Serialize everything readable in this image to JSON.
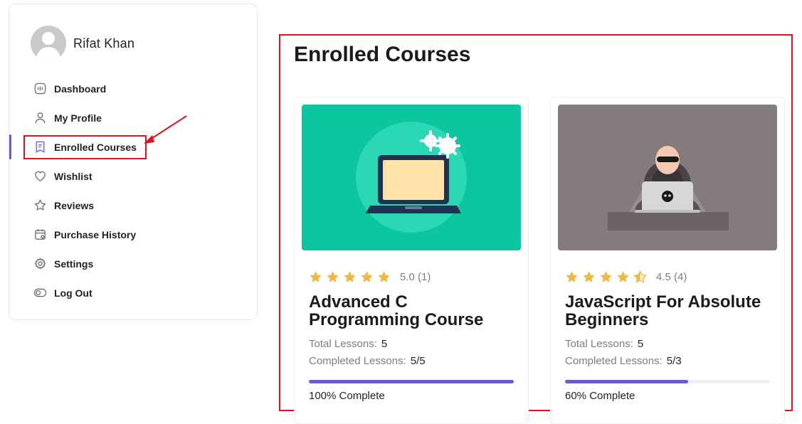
{
  "user": {
    "name": "Rifat Khan"
  },
  "sidebar": {
    "items": [
      {
        "label": "Dashboard",
        "icon": "dashboard-icon"
      },
      {
        "label": "My Profile",
        "icon": "user-icon"
      },
      {
        "label": "Enrolled Courses",
        "icon": "book-icon",
        "active": true
      },
      {
        "label": "Wishlist",
        "icon": "heart-icon"
      },
      {
        "label": "Reviews",
        "icon": "star-icon"
      },
      {
        "label": "Purchase History",
        "icon": "calendar-icon"
      },
      {
        "label": "Settings",
        "icon": "gear-icon"
      },
      {
        "label": "Log Out",
        "icon": "toggle-icon"
      }
    ]
  },
  "main": {
    "title": "Enrolled Courses",
    "courses": [
      {
        "title": "Advanced C Programming Course",
        "rating_value": 5.0,
        "rating_text": "5.0 (1)",
        "total_lessons_label": "Total Lessons:",
        "total_lessons": "5",
        "completed_lessons_label": "Completed Lessons:",
        "completed_lessons": "5/5",
        "progress": 1.0,
        "complete_text": "100% Complete",
        "thumbnail": "laptop-gears-illustration"
      },
      {
        "title": "JavaScript For Absolute Beginners",
        "rating_value": 4.5,
        "rating_text": "4.5 (4)",
        "total_lessons_label": "Total Lessons:",
        "total_lessons": "5",
        "completed_lessons_label": "Completed Lessons:",
        "completed_lessons": "5/3",
        "progress": 0.6,
        "complete_text": "60% Complete",
        "thumbnail": "hacker-laptop-illustration"
      }
    ]
  },
  "colors": {
    "accent": "#6e5ad7",
    "annotation_red": "#e0111b",
    "star": "#f4b740",
    "thumb1_bg": "#0bc6a0",
    "thumb2_bg": "#847b7d"
  }
}
